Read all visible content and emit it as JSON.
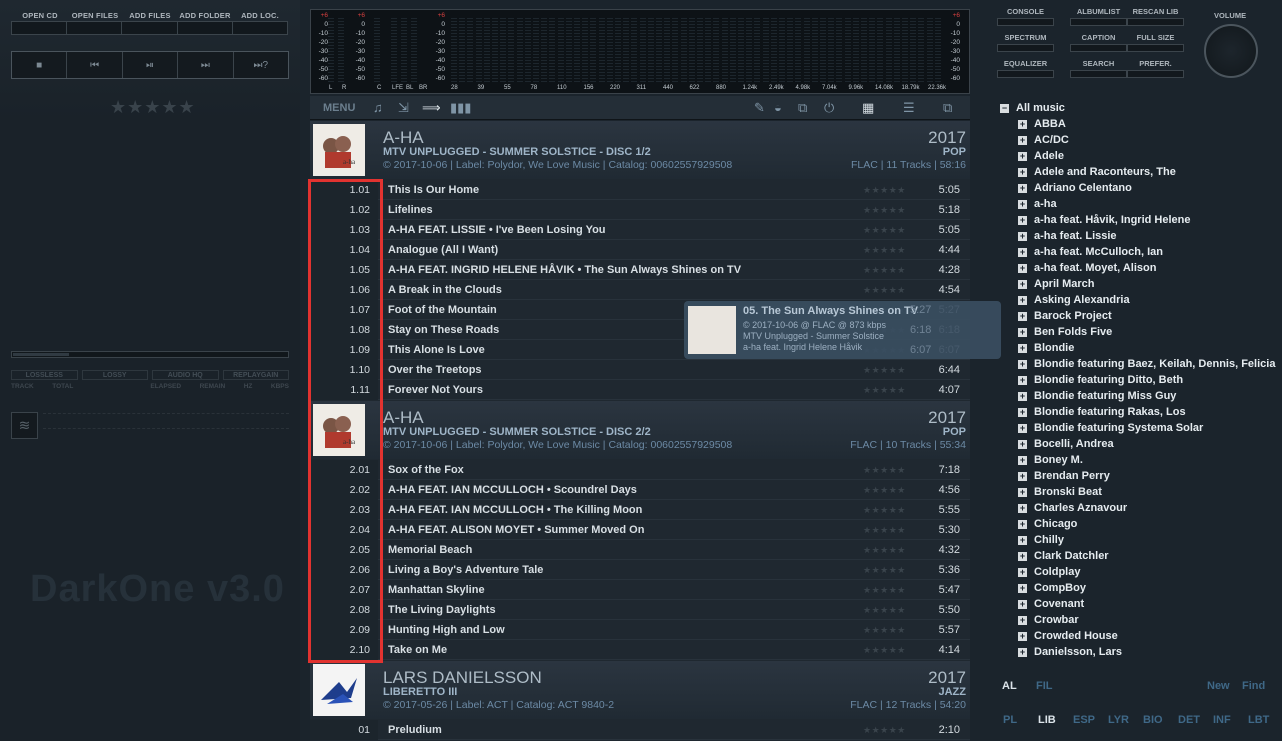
{
  "toolbar": {
    "buttons": [
      "OPEN CD",
      "OPEN FILES",
      "ADD FILES",
      "ADD FOLDER",
      "ADD LOC."
    ],
    "transport": [
      "■",
      "⏮",
      "⏯",
      "⏭",
      "⏭?"
    ]
  },
  "left_panel": {
    "rating": "★★★★★",
    "formats": [
      "LOSSLESS",
      "LOSSY",
      "AUDIO HQ",
      "REPLAYGAIN"
    ],
    "info_labels": [
      "TRACK",
      "TOTAL",
      "ELAPSED",
      "REMAIN",
      "HZ",
      "KBPS"
    ],
    "brand": "DarkOne v3.0"
  },
  "spectrum": {
    "scale": [
      "+6",
      "0",
      "-10",
      "-20",
      "-30",
      "-40",
      "-50",
      "-60"
    ],
    "channels": [
      "L",
      "R",
      "C",
      "LFE",
      "BL",
      "BR"
    ],
    "freqs": [
      "28",
      "39",
      "55",
      "78",
      "110",
      "156",
      "220",
      "311",
      "440",
      "622",
      "880",
      "1.24k",
      "2.49k",
      "4.98k",
      "7.04k",
      "9.96k",
      "14.08k",
      "18.79k",
      "22.36k"
    ]
  },
  "right_buttons": {
    "row1": [
      "CONSOLE",
      "ALBUMLIST",
      "RESCAN LIB"
    ],
    "row2": [
      "SPECTRUM",
      "CAPTION",
      "FULL SIZE"
    ],
    "row3": [
      "EQUALIZER",
      "SEARCH",
      "PREFER."
    ],
    "volume": "VOLUME"
  },
  "menubar": {
    "menu": "MENU"
  },
  "playlist": {
    "albums": [
      {
        "artist": "A-HA",
        "album": "MTV UNPLUGGED - SUMMER SOLSTICE - DISC 1/2",
        "meta": "© 2017-10-06 | Label: Polydor, We Love Music | Catalog: 00602557929508",
        "year": "2017",
        "genre": "POP",
        "info": "FLAC | 11 Tracks | 58:16",
        "tracks": [
          {
            "num": "1.01",
            "title": "This Is Our Home",
            "dur": "5:05"
          },
          {
            "num": "1.02",
            "title": "Lifelines",
            "dur": "5:18"
          },
          {
            "num": "1.03",
            "title": "A-HA FEAT. LISSIE • I've Been Losing You",
            "dur": "5:05"
          },
          {
            "num": "1.04",
            "title": "Analogue (All I Want)",
            "dur": "4:44"
          },
          {
            "num": "1.05",
            "title": "A-HA FEAT. INGRID HELENE HÅVIK • The Sun Always Shines on TV",
            "dur": "4:28"
          },
          {
            "num": "1.06",
            "title": "A Break in the Clouds",
            "dur": "4:54"
          },
          {
            "num": "1.07",
            "title": "Foot of the Mountain",
            "dur": "5:27"
          },
          {
            "num": "1.08",
            "title": "Stay on These Roads",
            "dur": "6:18"
          },
          {
            "num": "1.09",
            "title": "This Alone Is Love",
            "dur": "6:07"
          },
          {
            "num": "1.10",
            "title": "Over the Treetops",
            "dur": "6:44"
          },
          {
            "num": "1.11",
            "title": "Forever Not Yours",
            "dur": "4:07"
          }
        ]
      },
      {
        "artist": "A-HA",
        "album": "MTV UNPLUGGED - SUMMER SOLSTICE - DISC 2/2",
        "meta": "© 2017-10-06 | Label: Polydor, We Love Music | Catalog: 00602557929508",
        "year": "2017",
        "genre": "POP",
        "info": "FLAC | 10 Tracks | 55:34",
        "tracks": [
          {
            "num": "2.01",
            "title": "Sox of the Fox",
            "dur": "7:18"
          },
          {
            "num": "2.02",
            "title": "A-HA FEAT. IAN MCCULLOCH • Scoundrel Days",
            "dur": "4:56"
          },
          {
            "num": "2.03",
            "title": "A-HA FEAT. IAN MCCULLOCH • The Killing Moon",
            "dur": "5:55"
          },
          {
            "num": "2.04",
            "title": "A-HA FEAT. ALISON MOYET • Summer Moved On",
            "dur": "5:30"
          },
          {
            "num": "2.05",
            "title": "Memorial Beach",
            "dur": "4:32"
          },
          {
            "num": "2.06",
            "title": "Living a Boy's Adventure Tale",
            "dur": "5:36"
          },
          {
            "num": "2.07",
            "title": "Manhattan Skyline",
            "dur": "5:47"
          },
          {
            "num": "2.08",
            "title": "The Living Daylights",
            "dur": "5:50"
          },
          {
            "num": "2.09",
            "title": "Hunting High and Low",
            "dur": "5:57"
          },
          {
            "num": "2.10",
            "title": "Take on Me",
            "dur": "4:14"
          }
        ]
      },
      {
        "artist": "LARS DANIELSSON",
        "album": "LIBERETTO III",
        "meta": "© 2017-05-26 | Label: ACT | Catalog: ACT 9840-2",
        "year": "2017",
        "genre": "JAZZ",
        "info": "FLAC | 12 Tracks | 54:20",
        "tracks": [
          {
            "num": "01",
            "title": "Preludium",
            "dur": "2:10"
          }
        ]
      }
    ],
    "rating_stars": "★★★★★"
  },
  "tooltip": {
    "title": "05. The Sun Always Shines on TV",
    "line2": "© 2017-10-06 @ FLAC @ 873 kbps",
    "line3": "MTV Unplugged - Summer Solstice",
    "line4": "a-ha feat. Ingrid Helene Håvik"
  },
  "library": {
    "root": "All music",
    "items": [
      "ABBA",
      "AC/DC",
      "Adele",
      "Adele and Raconteurs, The",
      "Adriano Celentano",
      "a-ha",
      "a-ha feat. Håvik, Ingrid Helene",
      "a-ha feat. Lissie",
      "a-ha feat. McCulloch, Ian",
      "a-ha feat. Moyet, Alison",
      "April March",
      "Asking Alexandria",
      "Barock Project",
      "Ben Folds Five",
      "Blondie",
      "Blondie featuring Baez, Keilah, Dennis, Felicia",
      "Blondie featuring Ditto, Beth",
      "Blondie featuring Miss Guy",
      "Blondie featuring Rakas, Los",
      "Blondie featuring Systema Solar",
      "Bocelli, Andrea",
      "Boney M.",
      "Brendan Perry",
      "Bronski Beat",
      "Charles Aznavour",
      "Chicago",
      "Chilly",
      "Clark Datchler",
      "Coldplay",
      "CompBoy",
      "Covenant",
      "Crowbar",
      "Crowded House",
      "Danielsson, Lars"
    ],
    "tabs_top": [
      "AL",
      "FIL",
      "New",
      "Find"
    ],
    "tabs_bottom": [
      "PL",
      "LIB",
      "ESP",
      "LYR",
      "BIO",
      "DET",
      "INF",
      "LBT"
    ]
  }
}
